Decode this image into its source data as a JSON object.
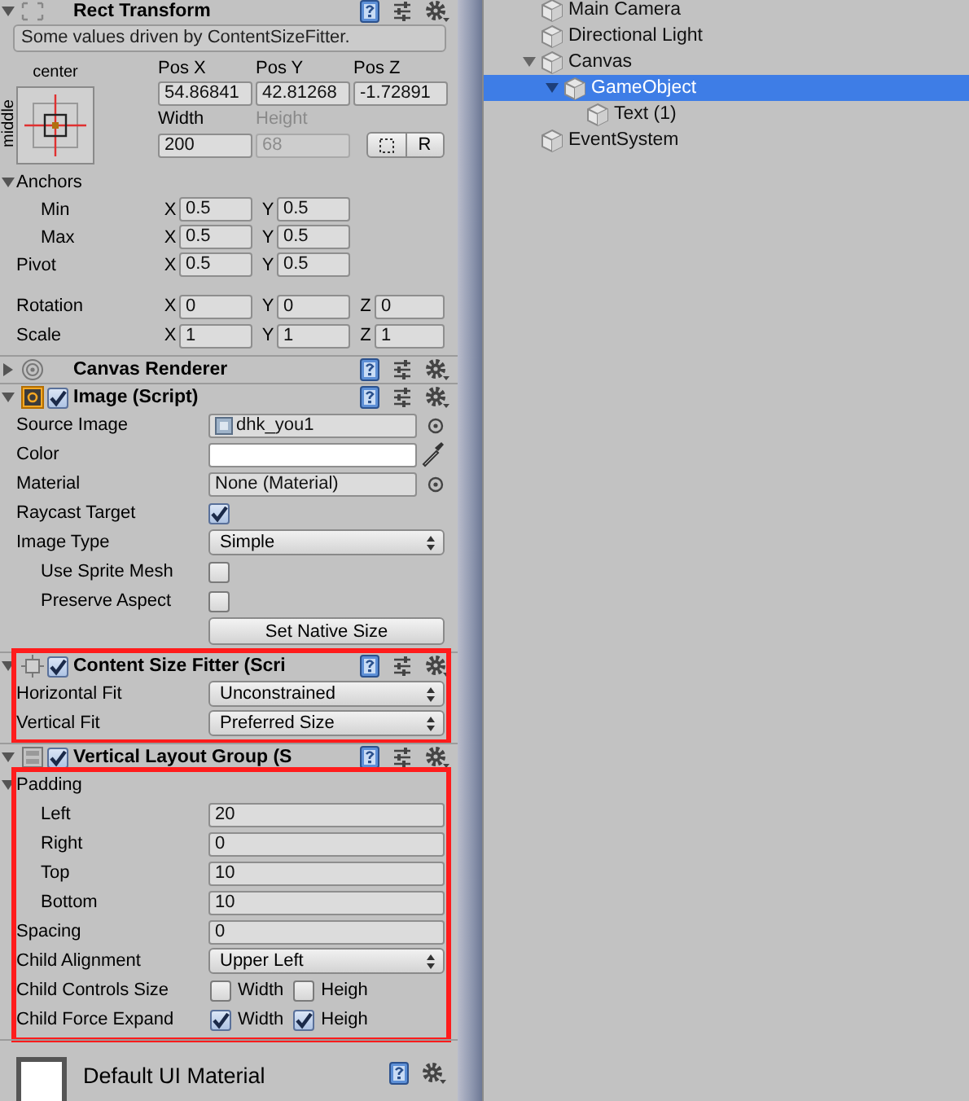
{
  "inspector": {
    "components": [
      {
        "kind": "rect_transform",
        "title": "Rect Transform",
        "expanded": true,
        "note": "Some values driven by ContentSizeFitter.",
        "anchor_preset": {
          "horizontal": "center",
          "vertical": "middle"
        },
        "position": [
          {
            "label": "Pos X",
            "value": "54.86841"
          },
          {
            "label": "Pos Y",
            "value": "42.81268"
          },
          {
            "label": "Pos Z",
            "value": "-1.72891"
          }
        ],
        "size": [
          {
            "label": "Width",
            "value": "200",
            "disabled": false
          },
          {
            "label": "Height",
            "value": "68",
            "disabled": true
          }
        ],
        "reset_button": "R",
        "anchor_rows": [
          {
            "kind": "foldout",
            "label": "Anchors",
            "expanded": true,
            "children": [
              {
                "kind": "vector",
                "label": "Min",
                "fields": [
                  {
                    "axis": "X",
                    "value": "0.5"
                  },
                  {
                    "axis": "Y",
                    "value": "0.5"
                  }
                ]
              },
              {
                "kind": "vector",
                "label": "Max",
                "fields": [
                  {
                    "axis": "X",
                    "value": "0.5"
                  },
                  {
                    "axis": "Y",
                    "value": "0.5"
                  }
                ]
              }
            ]
          },
          {
            "kind": "vector",
            "label": "Pivot",
            "fields": [
              {
                "axis": "X",
                "value": "0.5"
              },
              {
                "axis": "Y",
                "value": "0.5"
              }
            ]
          }
        ],
        "transform_rows": [
          {
            "kind": "vector",
            "label": "Rotation",
            "fields": [
              {
                "axis": "X",
                "value": "0"
              },
              {
                "axis": "Y",
                "value": "0"
              },
              {
                "axis": "Z",
                "value": "0"
              }
            ]
          },
          {
            "kind": "vector",
            "label": "Scale",
            "fields": [
              {
                "axis": "X",
                "value": "1"
              },
              {
                "axis": "Y",
                "value": "1"
              },
              {
                "axis": "Z",
                "value": "1"
              }
            ]
          }
        ]
      },
      {
        "kind": "plain",
        "title": "Canvas Renderer",
        "expanded": false
      },
      {
        "kind": "script",
        "title": "Image (Script)",
        "enabled": true,
        "expanded": true,
        "rows": [
          {
            "kind": "sprite",
            "label": "Source Image",
            "value": "dhk_you1"
          },
          {
            "kind": "color",
            "label": "Color",
            "color": "#ffffff"
          },
          {
            "kind": "object",
            "label": "Material",
            "value": "None (Material)"
          },
          {
            "kind": "checkbox",
            "label": "Raycast Target",
            "checked": true
          },
          {
            "kind": "dropdown",
            "label": "Image Type",
            "value": "Simple",
            "children": [
              {
                "kind": "checkbox",
                "label": "Use Sprite Mesh",
                "checked": false
              },
              {
                "kind": "checkbox",
                "label": "Preserve Aspect",
                "checked": false
              }
            ]
          },
          {
            "kind": "button",
            "label": "Set Native Size"
          }
        ]
      },
      {
        "kind": "script",
        "title": "Content Size Fitter (Scri",
        "enabled": true,
        "expanded": true,
        "highlighted": true,
        "rows": [
          {
            "kind": "dropdown",
            "label": "Horizontal Fit",
            "value": "Unconstrained"
          },
          {
            "kind": "dropdown",
            "label": "Vertical Fit",
            "value": "Preferred Size"
          }
        ]
      },
      {
        "kind": "script",
        "title": "Vertical Layout Group (S",
        "enabled": true,
        "expanded": true,
        "body_highlighted": true,
        "rows": [
          {
            "kind": "foldout",
            "label": "Padding",
            "expanded": true,
            "children": [
              {
                "kind": "text",
                "label": "Left",
                "value": "20"
              },
              {
                "kind": "text",
                "label": "Right",
                "value": "0"
              },
              {
                "kind": "text",
                "label": "Top",
                "value": "10"
              },
              {
                "kind": "text",
                "label": "Bottom",
                "value": "10"
              }
            ]
          },
          {
            "kind": "text",
            "label": "Spacing",
            "value": "0"
          },
          {
            "kind": "dropdown",
            "label": "Child Alignment",
            "value": "Upper Left"
          },
          {
            "kind": "toggles",
            "label": "Child Controls Size",
            "options": [
              {
                "label": "Width",
                "checked": false
              },
              {
                "label": "Heigh",
                "checked": false
              }
            ]
          },
          {
            "kind": "toggles",
            "label": "Child Force Expand",
            "options": [
              {
                "label": "Width",
                "checked": true
              },
              {
                "label": "Heigh",
                "checked": true
              }
            ]
          }
        ]
      },
      {
        "kind": "material",
        "title": "Default UI Material",
        "color": "#ffffff"
      }
    ]
  },
  "hierarchy": {
    "items": [
      {
        "label": "Main Camera",
        "selected": false
      },
      {
        "label": "Directional Light",
        "selected": false
      },
      {
        "label": "Canvas",
        "selected": false,
        "expanded": true,
        "children": [
          {
            "label": "GameObject",
            "selected": true,
            "expanded": true,
            "children": [
              {
                "label": "Text (1)",
                "selected": false
              }
            ]
          }
        ]
      },
      {
        "label": "EventSystem",
        "selected": false
      }
    ]
  }
}
